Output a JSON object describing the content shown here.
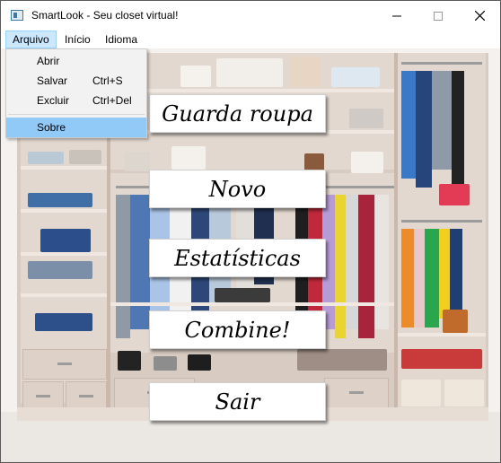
{
  "window": {
    "title": "SmartLook - Seu closet virtual!"
  },
  "menubar": {
    "items": [
      {
        "label": "Arquivo"
      },
      {
        "label": "Início"
      },
      {
        "label": "Idioma"
      }
    ]
  },
  "file_menu": {
    "items": [
      {
        "label": "Abrir",
        "shortcut": ""
      },
      {
        "label": "Salvar",
        "shortcut": "Ctrl+S"
      },
      {
        "label": "Excluir",
        "shortcut": "Ctrl+Del"
      },
      {
        "label": "Sobre",
        "shortcut": "",
        "highlighted": true
      }
    ]
  },
  "main_buttons": [
    {
      "label": "Guarda roupa"
    },
    {
      "label": "Novo"
    },
    {
      "label": "Estatísticas"
    },
    {
      "label": "Combine!"
    },
    {
      "label": "Sair"
    }
  ],
  "colors": {
    "menu_highlight": "#91c9f7",
    "menu_active": "#cce8ff",
    "closet_wood": "#e3d8cf"
  }
}
